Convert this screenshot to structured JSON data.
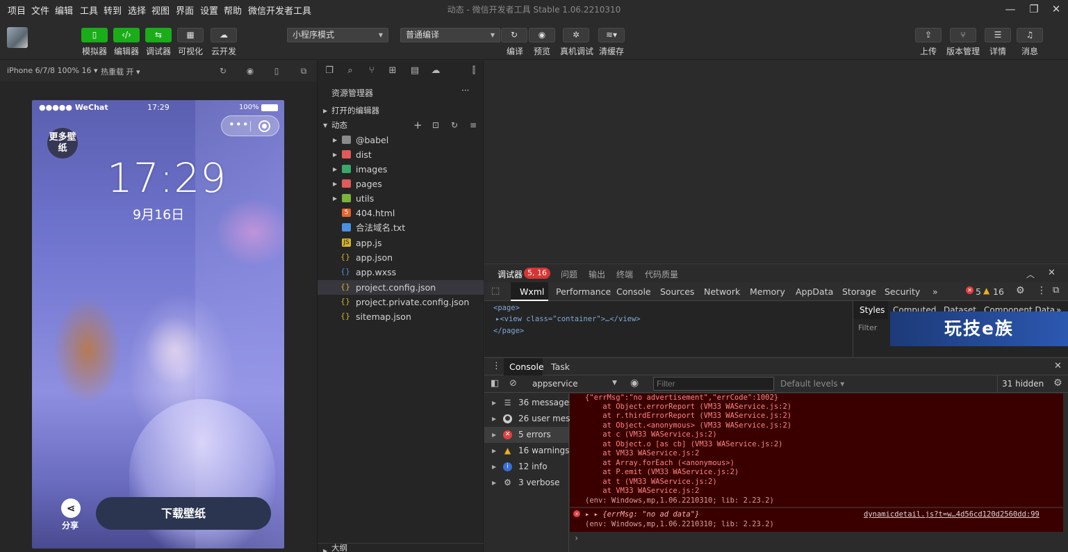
{
  "menubar": {
    "items": [
      "项目",
      "文件",
      "编辑",
      "工具",
      "转到",
      "选择",
      "视图",
      "界面",
      "设置",
      "帮助",
      "微信开发者工具"
    ],
    "title": "动态 - 微信开发者工具 Stable 1.06.2210310"
  },
  "toolbar": {
    "left_buttons": [
      {
        "label": "模拟器",
        "icon": "phone-icon"
      },
      {
        "label": "编辑器",
        "icon": "code-icon"
      },
      {
        "label": "调试器",
        "icon": "debug-icon"
      },
      {
        "label": "可视化",
        "icon": "layout-icon"
      },
      {
        "label": "云开发",
        "icon": "cloud-icon"
      }
    ],
    "mode_select": "小程序模式",
    "compile_select": "普通编译",
    "center_buttons": [
      {
        "label": "编译",
        "icon": "refresh-icon"
      },
      {
        "label": "预览",
        "icon": "eye-icon"
      },
      {
        "label": "真机调试",
        "icon": "bug-icon"
      },
      {
        "label": "清缓存",
        "icon": "layers-icon"
      }
    ],
    "right_buttons": [
      {
        "label": "上传",
        "icon": "upload-icon"
      },
      {
        "label": "版本管理",
        "icon": "branch-icon"
      },
      {
        "label": "详情",
        "icon": "menu-icon"
      },
      {
        "label": "消息",
        "icon": "bell-icon"
      }
    ]
  },
  "simulator": {
    "device": "iPhone 6/7/8 100% 16 ▾",
    "hot_reload": "热重载 开 ▾",
    "status_carrier": "●●●●● WeChat",
    "status_time": "17:29",
    "status_battery": "100%",
    "badge_text": "更多壁纸",
    "clock_time": "17:29",
    "clock_date": "9月16日",
    "share_label": "分享",
    "download_label": "下载壁纸"
  },
  "explorer": {
    "title": "资源管理器",
    "more": "···",
    "open_editors": "打开的编辑器",
    "project": "动态",
    "items": [
      {
        "label": "@babel",
        "type": "folder",
        "color": "#8a8a8a"
      },
      {
        "label": "dist",
        "type": "folder",
        "color": "#e05a5a"
      },
      {
        "label": "images",
        "type": "folder",
        "color": "#3aa86b"
      },
      {
        "label": "pages",
        "type": "folder",
        "color": "#e05a5a"
      },
      {
        "label": "utils",
        "type": "folder",
        "color": "#7bb33a"
      },
      {
        "label": "404.html",
        "type": "file",
        "color": "#e4652e"
      },
      {
        "label": "合法域名.txt",
        "type": "file",
        "color": "#4a8fe0"
      },
      {
        "label": "app.js",
        "type": "file",
        "color": "#d4b42a"
      },
      {
        "label": "app.json",
        "type": "json",
        "color": "#d4b42a"
      },
      {
        "label": "app.wxss",
        "type": "json",
        "color": "#4a8fe0"
      },
      {
        "label": "project.config.json",
        "type": "json",
        "color": "#d4b42a"
      },
      {
        "label": "project.private.config.json",
        "type": "json",
        "color": "#d4b42a"
      },
      {
        "label": "sitemap.json",
        "type": "json",
        "color": "#d4b42a"
      }
    ],
    "outline": "大纲"
  },
  "debugger": {
    "tabs": [
      "调试器",
      "问题",
      "输出",
      "终端",
      "代码质量"
    ],
    "badge": "5, 16",
    "devtools_tabs": [
      "Wxml",
      "Performance",
      "Console",
      "Sources",
      "Network",
      "Memory",
      "AppData",
      "Storage",
      "Security",
      "»"
    ],
    "error_count": "5",
    "warning_count": "16",
    "wxml_lines": [
      "<page>",
      "▸<view class=\"container\">…</view>",
      "</page>"
    ],
    "style_tabs": [
      "Styles",
      "Computed",
      "Dataset",
      "Component Data",
      "»"
    ],
    "filter_label": "Filter",
    "watermark": "玩技e族"
  },
  "console": {
    "tabs": [
      "Console",
      "Task"
    ],
    "context": "appservice",
    "filter_placeholder": "Filter",
    "levels": "Default levels ▾",
    "hidden": "31 hidden",
    "sidebar": [
      {
        "label": "36 messages",
        "icon": "list-icon"
      },
      {
        "label": "26 user mes...",
        "icon": "user-icon"
      },
      {
        "label": "5 errors",
        "icon": "error-icon"
      },
      {
        "label": "16 warnings",
        "icon": "warning-icon"
      },
      {
        "label": "12 info",
        "icon": "info-icon"
      },
      {
        "label": "3 verbose",
        "icon": "gear-icon"
      }
    ],
    "log_lines": [
      "{\"errMsg\":\"no advertisement\",\"errCode\":1002}",
      "    at Object.errorReport (VM33 WAService.js:2)",
      "    at r.thirdErrorReport (VM33 WAService.js:2)",
      "    at Object.<anonymous> (VM33 WAService.js:2)",
      "    at c (VM33 WAService.js:2)",
      "    at Object.o [as cb] (VM33 WAService.js:2)",
      "    at VM33 WAService.js:2",
      "    at Array.forEach (<anonymous>)",
      "    at P.emit (VM33 WAService.js:2)",
      "    at t (VM33 WAService.js:2)",
      "    at VM33 WAService.js:2",
      "(env: Windows,mp,1.06.2210310; lib: 2.23.2)"
    ],
    "error2": "▸ ▸ {errMsg: \"no ad data\"}",
    "error2_source": "dynamicdetail.js?t=w…4d56cd120d2560dd:99",
    "error2_env": "(env: Windows,mp,1.06.2210310; lib: 2.23.2)",
    "prompt": "›"
  }
}
